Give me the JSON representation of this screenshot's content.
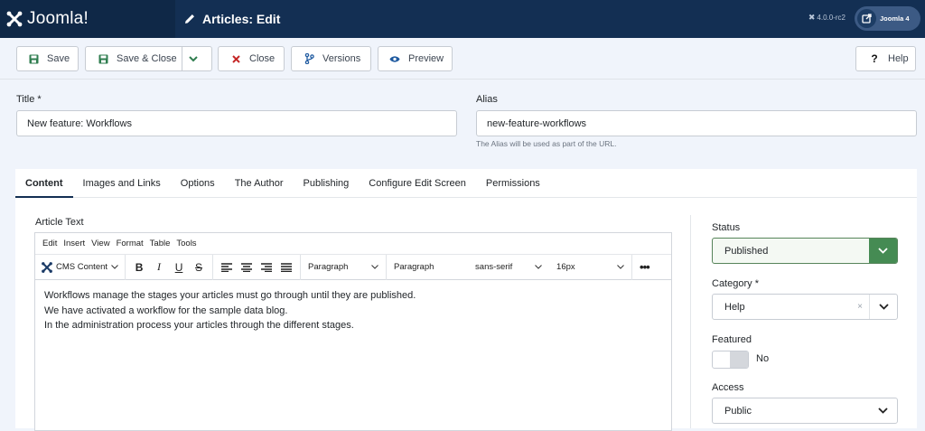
{
  "header": {
    "brand": "Joomla!",
    "title": "Articles: Edit",
    "version": "4.0.0-rc2",
    "user_menu": "Joomla 4"
  },
  "toolbar": {
    "save": "Save",
    "save_close": "Save & Close",
    "close": "Close",
    "versions": "Versions",
    "preview": "Preview",
    "help": "Help"
  },
  "form": {
    "title_label": "Title *",
    "title_value": "New feature: Workflows",
    "alias_label": "Alias",
    "alias_value": "new-feature-workflows",
    "alias_help": "The Alias will be used as part of the URL."
  },
  "tabs": [
    "Content",
    "Images and Links",
    "Options",
    "The Author",
    "Publishing",
    "Configure Edit Screen",
    "Permissions"
  ],
  "editor": {
    "label": "Article Text",
    "menu": [
      "Edit",
      "Insert",
      "View",
      "Format",
      "Table",
      "Tools"
    ],
    "cms_content": "CMS Content",
    "block_format": "Paragraph",
    "style_format": "Paragraph",
    "font_family": "sans-serif",
    "font_size": "16px",
    "lines": [
      "Workflows manage the stages your articles must go through until they are published.",
      "We have activated a workflow for the sample data blog.",
      "In the administration process your articles through the different stages."
    ]
  },
  "sidebar": {
    "status_label": "Status",
    "status_value": "Published",
    "category_label": "Category *",
    "category_value": "Help",
    "featured_label": "Featured",
    "featured_value": "No",
    "access_label": "Access",
    "access_value": "Public"
  },
  "colors": {
    "header_bg": "#132f53",
    "status_green": "#458b53",
    "close_red": "#c52827"
  }
}
